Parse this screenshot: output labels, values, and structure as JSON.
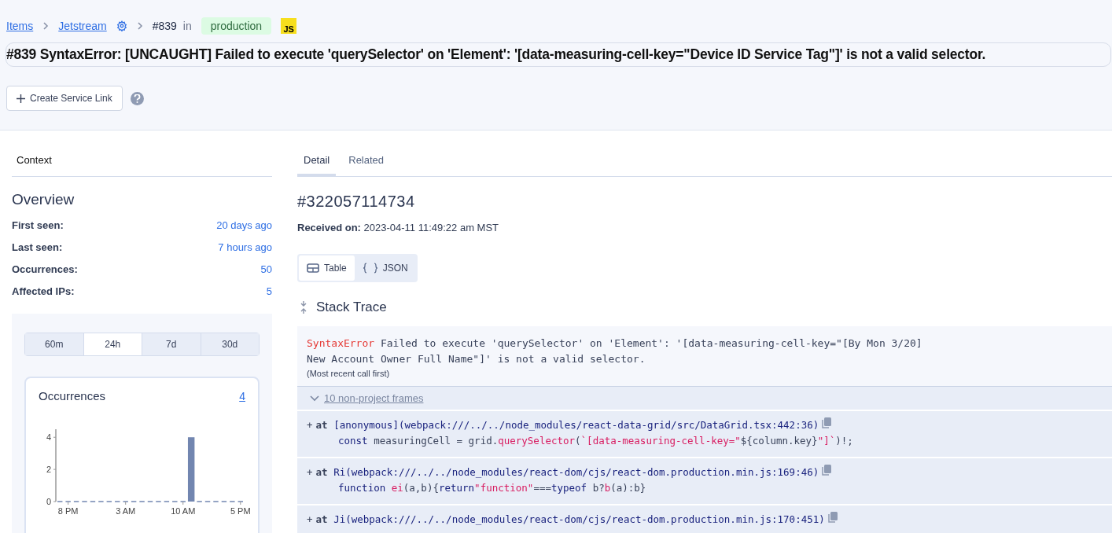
{
  "breadcrumbs": {
    "items": [
      {
        "label": "Items",
        "kind": "link"
      },
      {
        "label": "Jetstream",
        "kind": "link-settings"
      },
      {
        "label": "#839",
        "kind": "text"
      }
    ],
    "in_label": "in",
    "environment": "production",
    "platform": "JS"
  },
  "title": "#839 SyntaxError: [UNCAUGHT] Failed to execute 'querySelector' on 'Element': '[data-measuring-cell-key=\"Device ID Service Tag\"]' is not a valid selector.",
  "actions": {
    "create_button": "Create Service Link"
  },
  "sidebar": {
    "tab": "Context",
    "heading": "Overview",
    "stats": [
      {
        "label": "First seen:",
        "value": "20 days ago"
      },
      {
        "label": "Last seen:",
        "value": "7 hours ago"
      },
      {
        "label": "Occurrences:",
        "value": "50"
      },
      {
        "label": "Affected IPs:",
        "value": "5"
      }
    ],
    "ranges": [
      {
        "label": "60m",
        "selected": false
      },
      {
        "label": "24h",
        "selected": true
      },
      {
        "label": "7d",
        "selected": false
      },
      {
        "label": "30d",
        "selected": false
      }
    ],
    "occurrences_card": {
      "title": "Occurrences",
      "count": "4",
      "chart_data": {
        "type": "bar",
        "categories": [
          null,
          "8 PM",
          null,
          null,
          null,
          null,
          null,
          null,
          "3 AM",
          null,
          null,
          null,
          null,
          null,
          null,
          "10 AM",
          null,
          null,
          null,
          null,
          null,
          null,
          "5 PM"
        ],
        "series": [
          {
            "color": "#7286b0",
            "values": [
              0,
              0,
              0,
              0,
              0,
              0,
              0,
              0,
              0,
              0,
              0,
              0,
              0,
              0,
              0,
              0,
              4,
              0,
              0,
              0,
              0,
              0,
              0
            ]
          }
        ],
        "ylim": [
          0,
          4.5
        ],
        "yticks": [
          0,
          2,
          4
        ]
      }
    }
  },
  "detail": {
    "tabs": [
      {
        "label": "Detail",
        "selected": true
      },
      {
        "label": "Related",
        "selected": false
      }
    ],
    "id": "#322057114734",
    "received_label": "Received on:",
    "received_value": "2023-04-11 11:49:22 am MST",
    "view_toggle": [
      {
        "label": "Table",
        "kind": "table",
        "selected": true
      },
      {
        "label": "JSON",
        "kind": "json",
        "selected": false
      }
    ],
    "stack_trace": {
      "heading": "Stack Trace",
      "error_type": "SyntaxError",
      "error_message": "Failed to execute 'querySelector' on 'Element': '[data-measuring-cell-key=\"[By Mon 3/20]\nNew Account Owner Full Name\"]' is not a valid selector.",
      "note": "(Most recent call first)",
      "frames_toggle": "10 non-project frames",
      "expanded": true,
      "frames": [
        {
          "expand": "+",
          "at": "at",
          "function": "[anonymous]",
          "location": "(webpack:///../../node_modules/react-data-grid/src/DataGrid.tsx:442:36)",
          "code": [
            {
              "kind": "keyword",
              "text": "const"
            },
            {
              "kind": "plain",
              "text": " measuringCell = grid."
            },
            {
              "kind": "call",
              "text": "querySelector"
            },
            {
              "kind": "plain",
              "text": "("
            },
            {
              "kind": "string",
              "text": "`[data-measuring-cell-key=\""
            },
            {
              "kind": "plain",
              "text": "${column.key}"
            },
            {
              "kind": "string",
              "text": "\"]`"
            },
            {
              "kind": "plain",
              "text": ")!;"
            }
          ]
        },
        {
          "expand": "+",
          "at": "at",
          "function": "Ri",
          "location": "(webpack:///../../node_modules/react-dom/cjs/react-dom.production.min.js:169:46)",
          "code": [
            {
              "kind": "keyword",
              "text": "function"
            },
            {
              "kind": "call",
              "text": " ei"
            },
            {
              "kind": "plain",
              "text": "(a,b){"
            },
            {
              "kind": "keyword",
              "text": "return"
            },
            {
              "kind": "string",
              "text": "\"function\""
            },
            {
              "kind": "plain",
              "text": "==="
            },
            {
              "kind": "keyword",
              "text": "typeof"
            },
            {
              "kind": "plain",
              "text": " b?"
            },
            {
              "kind": "call",
              "text": "b"
            },
            {
              "kind": "plain",
              "text": "(a):b}"
            }
          ]
        },
        {
          "expand": "+",
          "at": "at",
          "function": "Ji",
          "location": "(webpack:///../../node_modules/react-dom/cjs/react-dom.production.min.js:170:451)"
        }
      ]
    }
  }
}
